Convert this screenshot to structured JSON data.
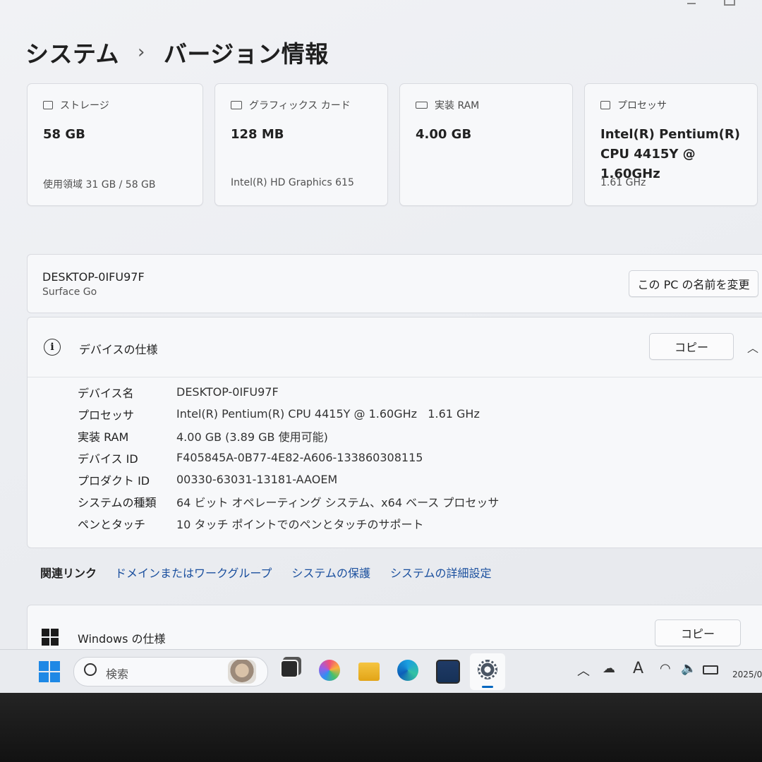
{
  "breadcrumb": {
    "parent": "システム",
    "separator": "›",
    "current": "バージョン情報"
  },
  "cards": [
    {
      "icon": "storage-icon",
      "label": "ストレージ",
      "value": "58 GB",
      "sub": "使用領域 31 GB / 58 GB"
    },
    {
      "icon": "graphics-card-icon",
      "label": "グラフィックス カード",
      "value": "128 MB",
      "sub": "Intel(R) HD Graphics 615"
    },
    {
      "icon": "ram-icon",
      "label": "実装 RAM",
      "value": "4.00 GB",
      "sub": ""
    },
    {
      "icon": "processor-icon",
      "label": "プロセッサ",
      "value_line1": "Intel(R) Pentium(R)",
      "value_line2": "CPU 4415Y @ 1.60GHz",
      "sub": "1.61 GHz"
    }
  ],
  "device": {
    "name": "DESKTOP-0IFU97F",
    "model": "Surface Go",
    "rename_label": "この PC の名前を変更"
  },
  "device_specs": {
    "title": "デバイスの仕様",
    "copy_label": "コピー",
    "rows": [
      {
        "key": "デバイス名",
        "value": "DESKTOP-0IFU97F"
      },
      {
        "key": "プロセッサ",
        "value": "Intel(R) Pentium(R) CPU 4415Y @ 1.60GHz   1.61 GHz"
      },
      {
        "key": "実装 RAM",
        "value": "4.00 GB (3.89 GB 使用可能)"
      },
      {
        "key": "デバイス ID",
        "value": "F405845A-0B77-4E82-A606-133860308115"
      },
      {
        "key": "プロダクト ID",
        "value": "00330-63031-13181-AAOEM"
      },
      {
        "key": "システムの種類",
        "value": "64 ビット オペレーティング システム、x64 ベース プロセッサ"
      },
      {
        "key": "ペンとタッチ",
        "value": "10 タッチ ポイントでのペンとタッチのサポート"
      }
    ]
  },
  "related_links": {
    "title": "関連リンク",
    "links": [
      "ドメインまたはワークグループ",
      "システムの保護",
      "システムの詳細設定"
    ]
  },
  "windows_specs": {
    "title": "Windows の仕様",
    "copy_label": "コピー"
  },
  "taskbar": {
    "search_placeholder": "検索",
    "input_indicator": "A",
    "clock_partial": "2025/0"
  },
  "colors": {
    "accent": "#0067c0",
    "link": "#1a4f9e"
  }
}
